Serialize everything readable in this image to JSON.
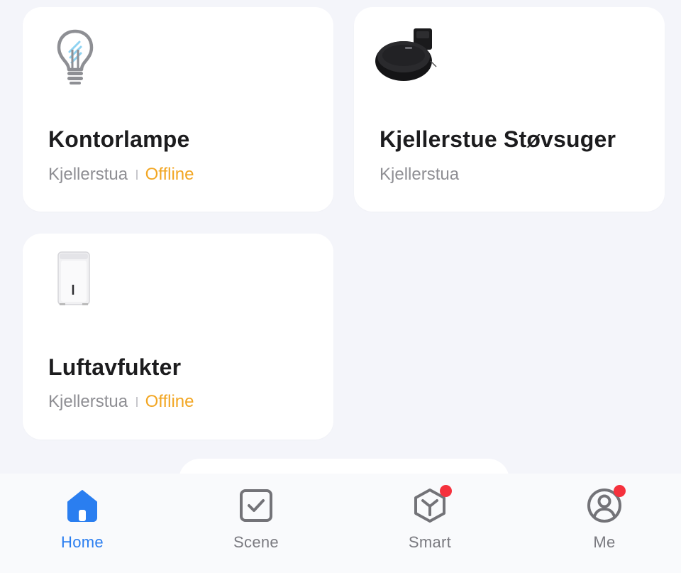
{
  "devices": [
    {
      "name": "Kontorlampe",
      "room": "Kjellerstua",
      "status": "Offline",
      "icon": "light-bulb-icon"
    },
    {
      "name": "Kjellerstue Støvsuger",
      "room": "Kjellerstua",
      "status": "",
      "icon": "robot-vacuum-icon"
    },
    {
      "name": "Luftavfukter",
      "room": "Kjellerstua",
      "status": "Offline",
      "icon": "dehumidifier-icon"
    }
  ],
  "tabbar": {
    "home": "Home",
    "scene": "Scene",
    "smart": "Smart",
    "me": "Me"
  },
  "colors": {
    "background": "#f4f5fa",
    "card": "#ffffff",
    "accent": "#2a7ef0",
    "offline": "#f2a623",
    "muted_text": "#8e8e93",
    "badge": "#f5313d"
  }
}
